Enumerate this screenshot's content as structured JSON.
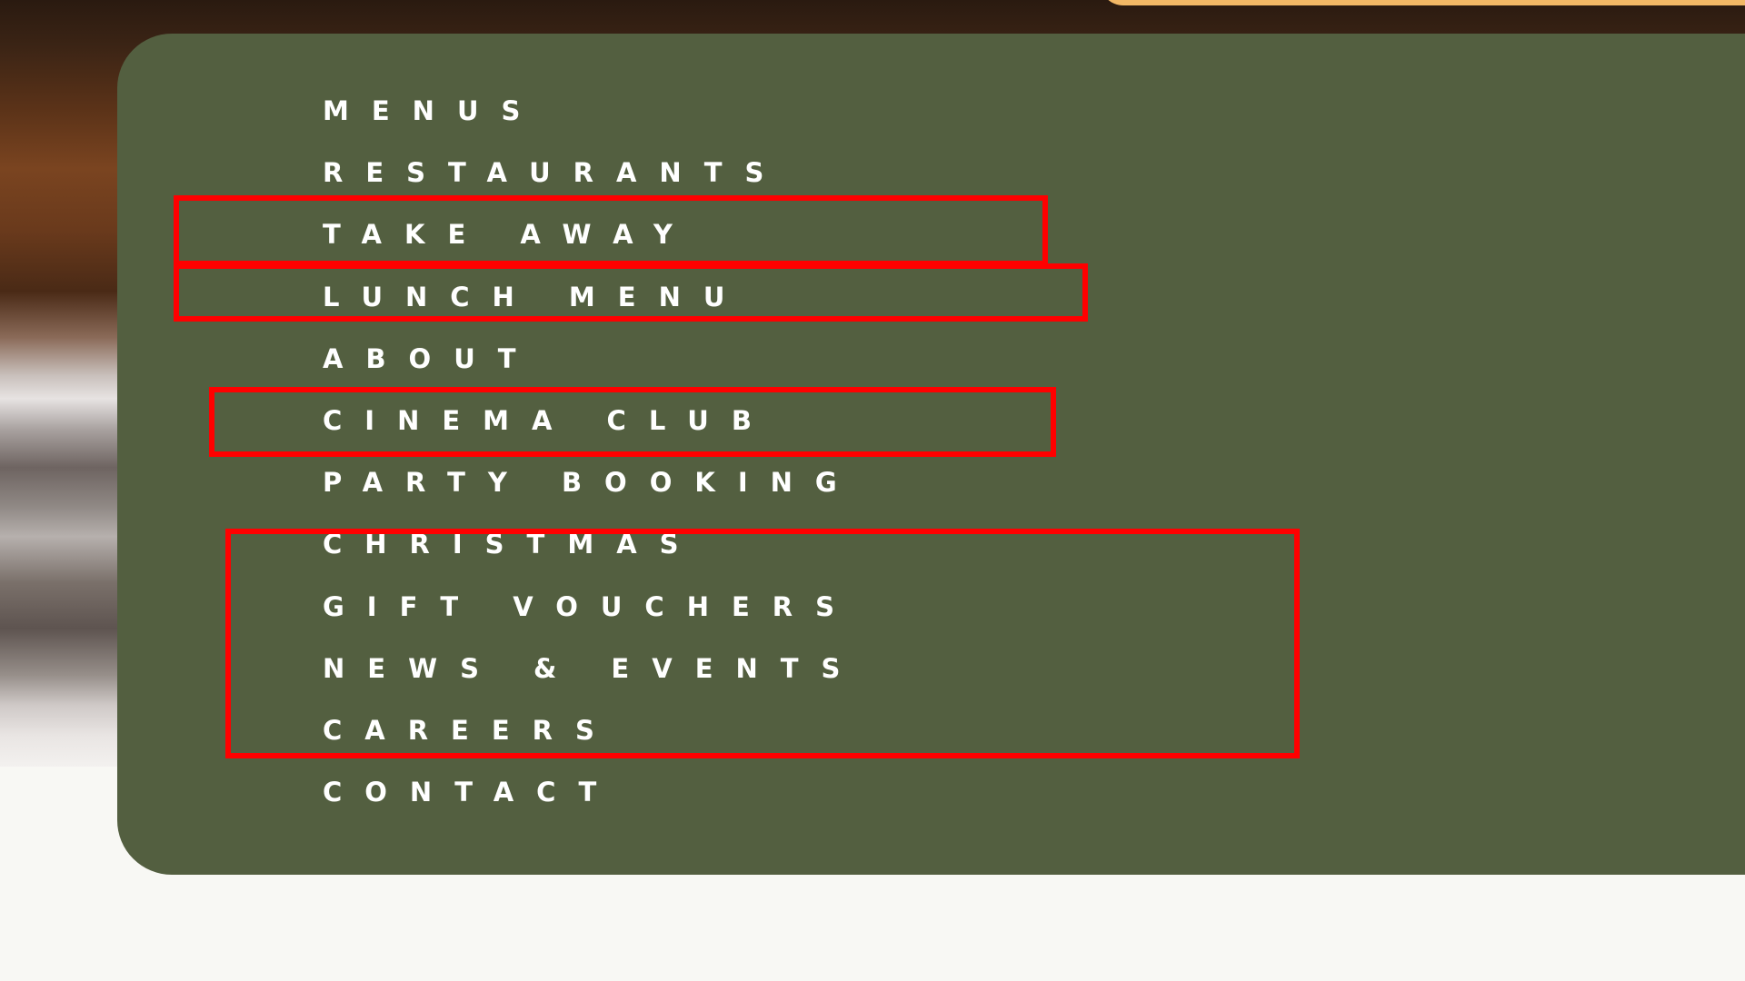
{
  "menu": {
    "items": [
      {
        "label": "MENUS"
      },
      {
        "label": "RESTAURANTS"
      },
      {
        "label": "TAKE AWAY"
      },
      {
        "label": "LUNCH MENU"
      },
      {
        "label": "ABOUT"
      },
      {
        "label": "CINEMA CLUB"
      },
      {
        "label": "PARTY BOOKING"
      },
      {
        "label": "CHRISTMAS"
      },
      {
        "label": "GIFT VOUCHERS"
      },
      {
        "label": "NEWS & EVENTS"
      },
      {
        "label": "CAREERS"
      },
      {
        "label": "CONTACT"
      }
    ]
  },
  "colors": {
    "panel": "#535f40",
    "text": "#ffffff",
    "highlight_box": "#ff0000",
    "accent": "#f2b866"
  }
}
